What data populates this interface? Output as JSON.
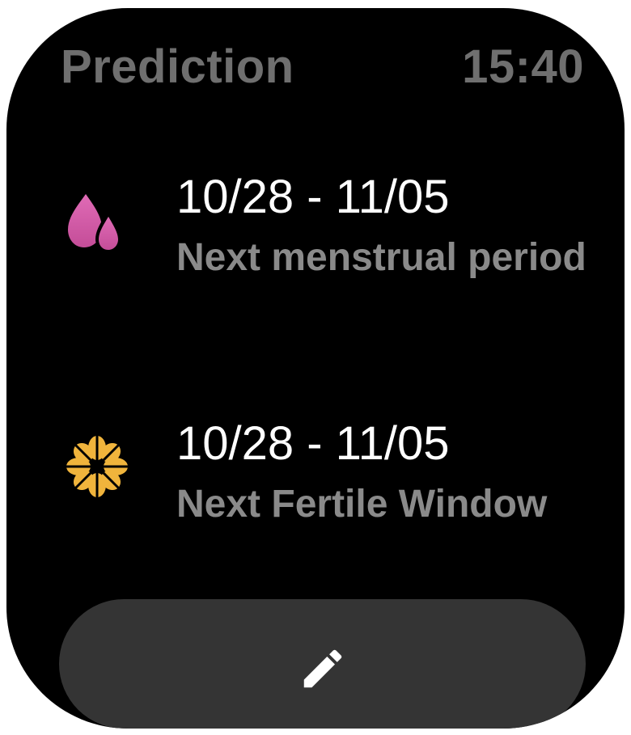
{
  "header": {
    "title": "Prediction",
    "time": "15:40"
  },
  "entries": [
    {
      "date_range": "10/28 - 11/05",
      "label": "Next menstrual period",
      "icon": "droplets-icon",
      "icon_color": "#d35aa8"
    },
    {
      "date_range": "10/28 - 11/05",
      "label": "Next Fertile Window",
      "icon": "flower-icon",
      "icon_color": "#f0b43c"
    }
  ],
  "edit_button": {
    "icon": "pencil-icon",
    "color": "#ffffff"
  },
  "colors": {
    "background": "#000000",
    "button": "#343434",
    "muted_text": "#8a8a8a",
    "header_text": "#6f6f6f"
  }
}
